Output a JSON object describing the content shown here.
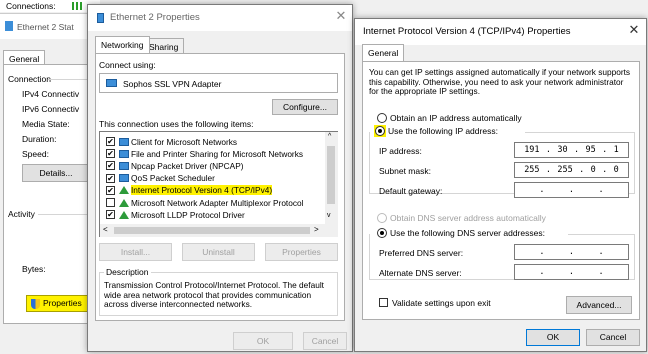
{
  "back_window": {
    "connections_label": "Connections:",
    "title": "Ethernet 2 Stat",
    "tab": "General",
    "section_connection": "Connection",
    "rows": [
      "IPv4 Connectiv",
      "IPv6 Connectiv",
      "Media State:",
      "Duration:",
      "Speed:"
    ],
    "details_button": "Details...",
    "section_activity": "Activity",
    "bytes_label": "Bytes:",
    "properties_button": "Properties"
  },
  "eth_props": {
    "title": "Ethernet 2 Properties",
    "tabs": [
      "Networking",
      "Sharing"
    ],
    "connect_using_label": "Connect using:",
    "adapter": "Sophos SSL VPN Adapter",
    "configure_button": "Configure...",
    "items_label": "This connection uses the following items:",
    "items": [
      {
        "label": "Client for Microsoft Networks",
        "checked": true,
        "icon": "computer-icon"
      },
      {
        "label": "File and Printer Sharing for Microsoft Networks",
        "checked": true,
        "icon": "computer-icon"
      },
      {
        "label": "Npcap Packet Driver (NPCAP)",
        "checked": true,
        "icon": "computer-icon"
      },
      {
        "label": "QoS Packet Scheduler",
        "checked": true,
        "icon": "computer-icon"
      },
      {
        "label": "Internet Protocol Version 4 (TCP/IPv4)",
        "checked": true,
        "icon": "protocol-icon"
      },
      {
        "label": "Microsoft Network Adapter Multiplexor Protocol",
        "checked": false,
        "icon": "protocol-icon"
      },
      {
        "label": "Microsoft LLDP Protocol Driver",
        "checked": true,
        "icon": "protocol-icon"
      }
    ],
    "install_button": "Install...",
    "uninstall_button": "Uninstall",
    "properties_button": "Properties",
    "description_label": "Description",
    "description_text": "Transmission Control Protocol/Internet Protocol. The default wide area network protocol that provides communication across diverse interconnected networks.",
    "ok_button": "OK",
    "cancel_button": "Cancel"
  },
  "ipv4": {
    "title": "Internet Protocol Version 4 (TCP/IPv4) Properties",
    "tab": "General",
    "intro": "You can get IP settings assigned automatically if your network supports this capability. Otherwise, you need to ask your network administrator for the appropriate IP settings.",
    "auto_ip": "Obtain an IP address automatically",
    "use_ip": "Use the following IP address:",
    "ip_label": "IP address:",
    "ip_value": [
      "191",
      "30",
      "95",
      "1"
    ],
    "mask_label": "Subnet mask:",
    "mask_value": [
      "255",
      "255",
      "0",
      "0"
    ],
    "gateway_label": "Default gateway:",
    "auto_dns": "Obtain DNS server address automatically",
    "use_dns": "Use the following DNS server addresses:",
    "pref_dns_label": "Preferred DNS server:",
    "alt_dns_label": "Alternate DNS server:",
    "validate_label": "Validate settings upon exit",
    "advanced_button": "Advanced...",
    "ok_button": "OK",
    "cancel_button": "Cancel"
  }
}
